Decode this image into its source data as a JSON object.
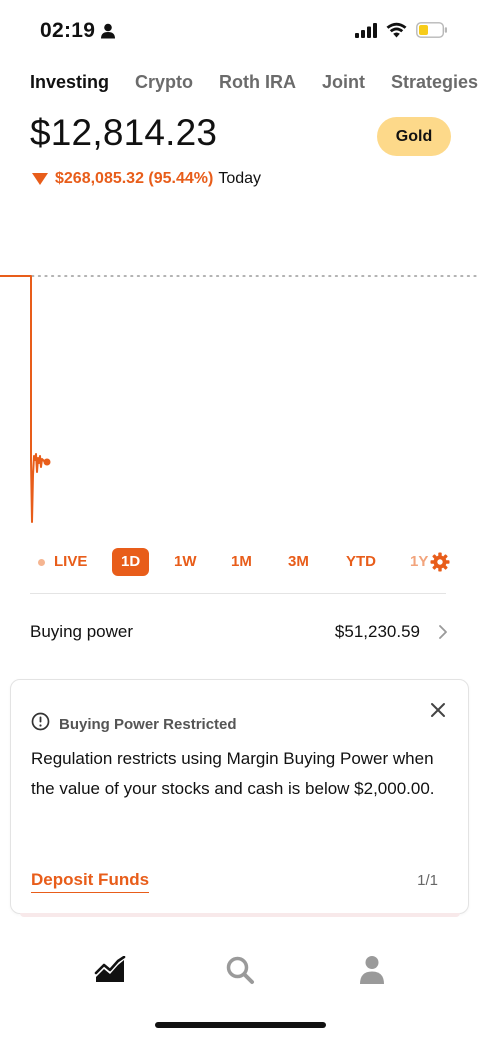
{
  "status_bar": {
    "time": "02:19"
  },
  "tabs": [
    {
      "label": "Investing",
      "active": true
    },
    {
      "label": "Crypto",
      "active": false
    },
    {
      "label": "Roth IRA",
      "active": false
    },
    {
      "label": "Joint",
      "active": false
    },
    {
      "label": "Strategies",
      "active": false
    }
  ],
  "portfolio": {
    "value": "$12,814.23",
    "change": "$268,085.32 (95.44%)",
    "change_period": "Today",
    "gold_label": "Gold"
  },
  "ranges": [
    {
      "label": "LIVE"
    },
    {
      "label": "1D",
      "active": true
    },
    {
      "label": "1W"
    },
    {
      "label": "1M"
    },
    {
      "label": "3M"
    },
    {
      "label": "YTD"
    },
    {
      "label": "1Y"
    }
  ],
  "buying_power": {
    "label": "Buying power",
    "value": "$51,230.59"
  },
  "notice": {
    "title": "Buying Power Restricted",
    "body": "Regulation restricts using Margin Buying Power when the value of your stocks and cash is below $2,000.00.",
    "action_label": "Deposit Funds",
    "pager": "1/1"
  },
  "colors": {
    "accent": "#e85d1a",
    "gold": "#fdd98a"
  },
  "icons": {
    "status": [
      "person-icon",
      "signal-icon",
      "wifi-icon",
      "battery-icon"
    ],
    "nav": [
      "portfolio-chart-icon",
      "search-icon",
      "account-icon"
    ]
  }
}
